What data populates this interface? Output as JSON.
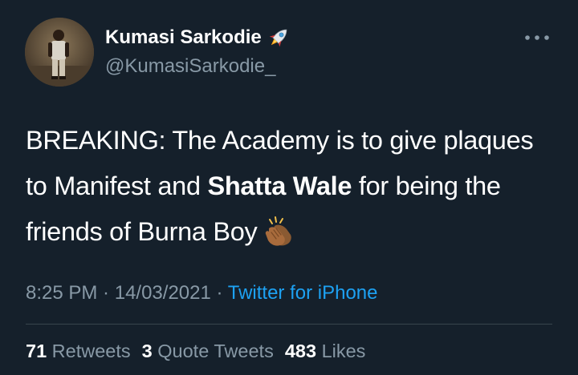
{
  "author": {
    "display_name": "Kumasi Sarkodie",
    "handle": "@KumasiSarkodie_",
    "name_emoji": "rocket-icon",
    "avatar": "avatar-photo"
  },
  "tweet": {
    "text_part1": "BREAKING: The Academy is to give plaques to Manifest and ",
    "text_bold": "Shatta Wale",
    "text_part2": " for being the friends of Burna Boy",
    "trailing_emoji": "clapping-hands-icon"
  },
  "meta": {
    "time": "8:25 PM",
    "separator1": " · ",
    "date": "14/03/2021",
    "separator2": " · ",
    "source": "Twitter for iPhone"
  },
  "stats": {
    "retweets_count": "71",
    "retweets_label": " Retweets",
    "quotes_count": "3",
    "quotes_label": " Quote Tweets",
    "likes_count": "483",
    "likes_label": " Likes"
  },
  "colors": {
    "background": "#15202b",
    "primary_text": "#ffffff",
    "secondary_text": "#8899a6",
    "link": "#1da1f2",
    "divider": "#38444d"
  }
}
